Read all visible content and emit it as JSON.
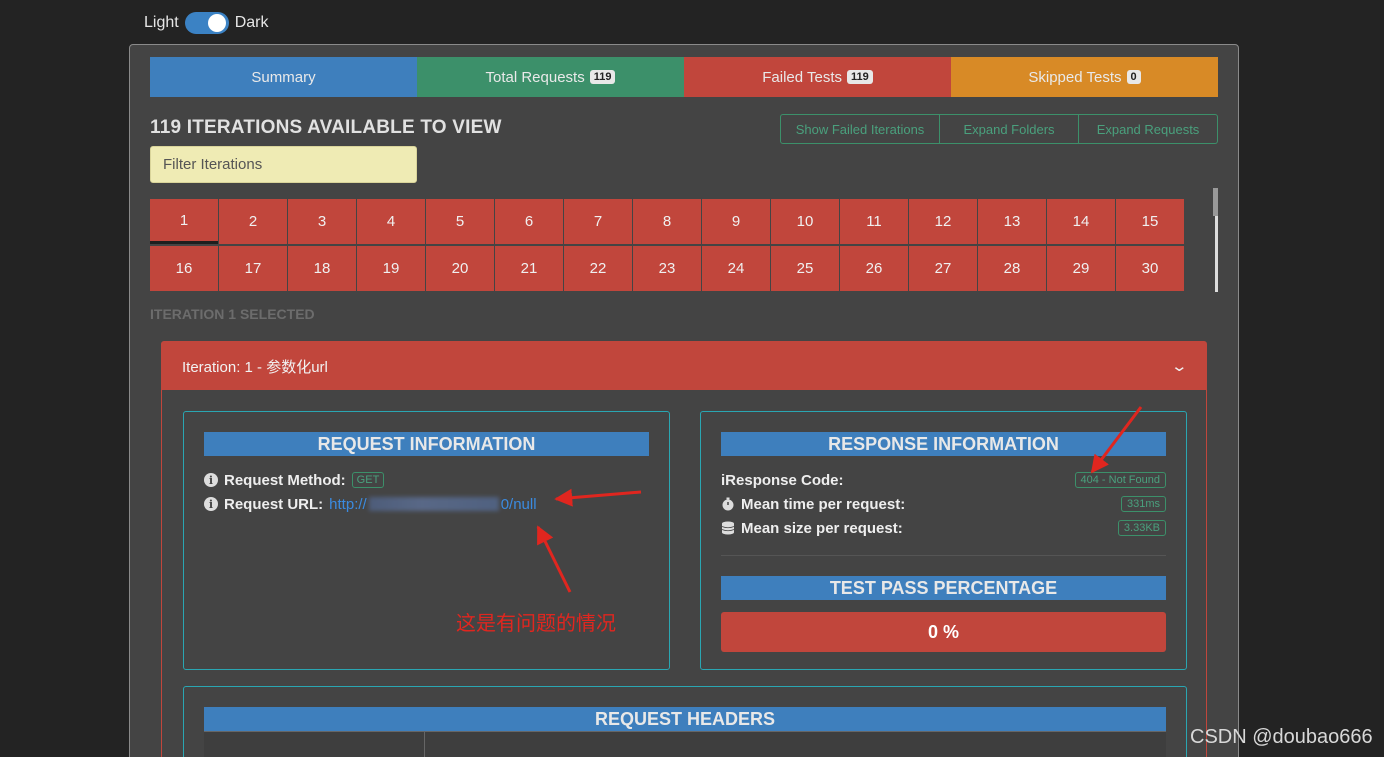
{
  "theme": {
    "light_label": "Light",
    "dark_label": "Dark"
  },
  "tabs": [
    {
      "label": "Summary",
      "badge": ""
    },
    {
      "label": "Total Requests",
      "badge": "119"
    },
    {
      "label": "Failed Tests",
      "badge": "119"
    },
    {
      "label": "Skipped Tests",
      "badge": "0"
    }
  ],
  "iterations": {
    "title": "119 ITERATIONS AVAILABLE TO VIEW",
    "buttons": {
      "show_failed": "Show Failed Iterations",
      "expand_folders": "Expand Folders",
      "expand_requests": "Expand Requests"
    },
    "filter_placeholder": "Filter Iterations",
    "cells": [
      "1",
      "2",
      "3",
      "4",
      "5",
      "6",
      "7",
      "8",
      "9",
      "10",
      "11",
      "12",
      "13",
      "14",
      "15",
      "16",
      "17",
      "18",
      "19",
      "20",
      "21",
      "22",
      "23",
      "24",
      "25",
      "26",
      "27",
      "28",
      "29",
      "30"
    ],
    "selected_label": "ITERATION 1 SELECTED"
  },
  "iteration_card": {
    "header": "Iteration: 1 - 参数化url",
    "request_info": {
      "title": "REQUEST INFORMATION",
      "method_label": "Request Method:",
      "method_value": "GET",
      "url_label": "Request URL:",
      "url_prefix": "http://",
      "url_suffix": "0/null"
    },
    "response_info": {
      "title": "RESPONSE INFORMATION",
      "code_label": "Response Code:",
      "code_value": "404 - Not Found",
      "time_label": "Mean time per request:",
      "time_value": "331ms",
      "size_label": "Mean size per request:",
      "size_value": "3.33KB",
      "pass_title": "TEST PASS PERCENTAGE",
      "pass_value": "0 %"
    },
    "headers_title": "REQUEST HEADERS"
  },
  "annotation": "这是有问题的情况",
  "watermark": "CSDN @doubao666",
  "colors": {
    "summary": "#3e7fbd",
    "total": "#3c906a",
    "failed": "#c1463c",
    "skipped": "#d88a26",
    "annotation": "#e0261f"
  }
}
